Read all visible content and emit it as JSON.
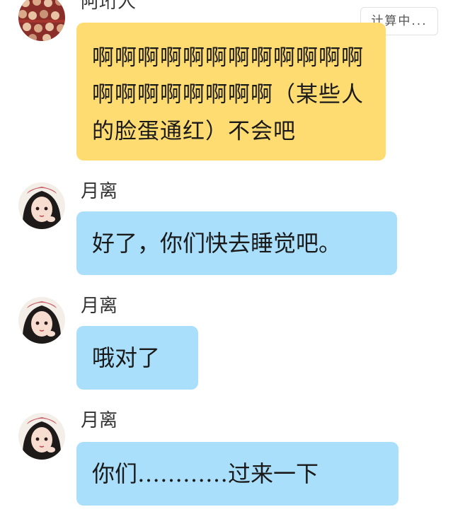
{
  "status_label": "计算中...",
  "messages": [
    {
      "sender": "阿珩人",
      "text": "啊啊啊啊啊啊啊啊啊啊啊啊啊啊啊啊啊啊啊啊（某些人的脸蛋通红）不会吧",
      "bubble_color": "#ffdc72"
    },
    {
      "sender": "月离",
      "text": "好了，你们快去睡觉吧。",
      "bubble_color": "#a9dffb"
    },
    {
      "sender": "月离",
      "text": "哦对了",
      "bubble_color": "#a9dffb"
    },
    {
      "sender": "月离",
      "text": "你们…………过来一下",
      "bubble_color": "#a9dffb"
    }
  ],
  "icons": {
    "first_avatar": "crowd-avatar",
    "others_avatar": "girl-avatar"
  }
}
